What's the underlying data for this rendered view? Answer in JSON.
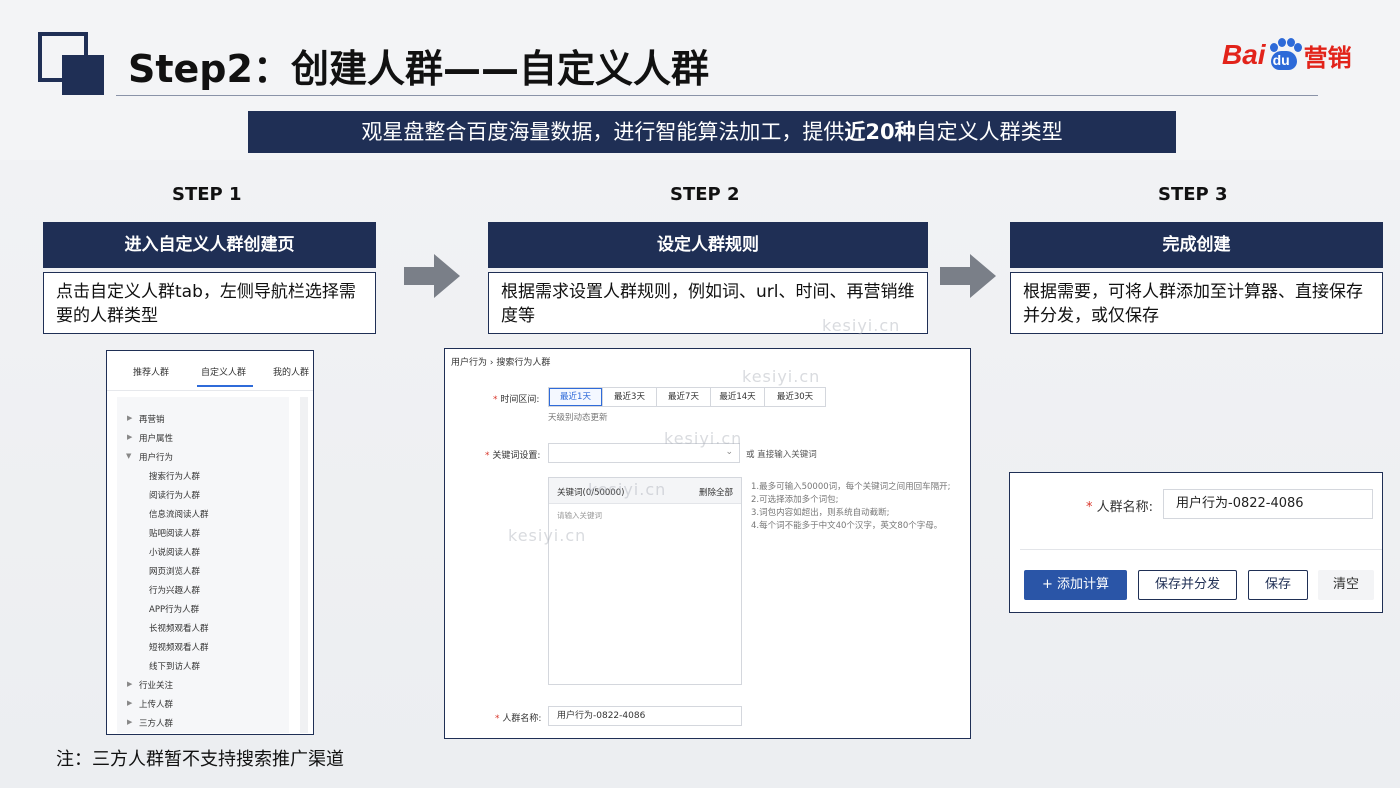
{
  "title": "Step2：创建人群——自定义人群",
  "brand": {
    "bai": "Bai",
    "du": "du",
    "yingxiao": "营销"
  },
  "banner": {
    "before": "观星盘整合百度海量数据，进行智能算法加工，提供",
    "bold": "近20种",
    "after": "自定义人群类型"
  },
  "steps": [
    {
      "label": "STEP 1",
      "heading": "进入自定义人群创建页",
      "desc": "点击自定义人群tab，左侧导航栏选择需要的人群类型"
    },
    {
      "label": "STEP 2",
      "heading": "设定人群规则",
      "desc": "根据需求设置人群规则，例如词、url、时间、再营销维度等"
    },
    {
      "label": "STEP 3",
      "heading": "完成创建",
      "desc": "根据需要，可将人群添加至计算器、直接保存并分发，或仅保存"
    }
  ],
  "panel1": {
    "tabs": [
      "推荐人群",
      "自定义人群",
      "我的人群"
    ],
    "active_tab": "自定义人群",
    "groups_before": [
      "再营销",
      "用户属性"
    ],
    "open_group": "用户行为",
    "children": [
      "搜索行为人群",
      "阅读行为人群",
      "信息流阅读人群",
      "贴吧阅读人群",
      "小说阅读人群",
      "网页浏览人群",
      "行为兴趣人群",
      "APP行为人群",
      "长视频观看人群",
      "短视频观看人群",
      "线下到访人群"
    ],
    "groups_after": [
      "行业关注",
      "上传人群",
      "三方人群"
    ]
  },
  "panel2": {
    "breadcrumb": "用户行为 › 搜索行为人群",
    "time_label": "时间区间:",
    "time_options": [
      "最近1天",
      "最近3天",
      "最近7天",
      "最近14天",
      "最近30天"
    ],
    "time_active": "最近1天",
    "time_hint": "天级别动态更新",
    "keyword_label": "关键词设置:",
    "keyword_or": "或 直接输入关键词",
    "kw_title": "关键词(0/50000)",
    "kw_delete": "删除全部",
    "kw_placeholder": "请输入关键词",
    "rules": [
      "1.最多可输入50000词，每个关键词之间用回车隔开;",
      "2.可选择添加多个词包;",
      "3.词包内容如超出，则系统自动截断;",
      "4.每个词不能多于中文40个汉字，英文80个字母。"
    ],
    "name_label": "人群名称:",
    "name_value": "用户行为-0822-4086"
  },
  "panel3": {
    "name_label": "人群名称:",
    "name_value": "用户行为-0822-4086",
    "buttons": [
      "+ 添加计算",
      "保存并分发",
      "保存",
      "清空"
    ]
  },
  "watermarks": [
    "kesiyi.cn",
    "kesiyi.cn",
    "kesiyi.cn",
    "kesiyi.cn",
    "kesiyi.cn"
  ],
  "note": "注：三方人群暂不支持搜索推广渠道",
  "colors": {
    "navy": "#1f2f55",
    "primary_blue": "#2a55a7",
    "active_blue": "#2f6bd9",
    "required_red": "#d9362b",
    "brand_red": "#e2231a",
    "brand_blue": "#2d6ad8"
  }
}
